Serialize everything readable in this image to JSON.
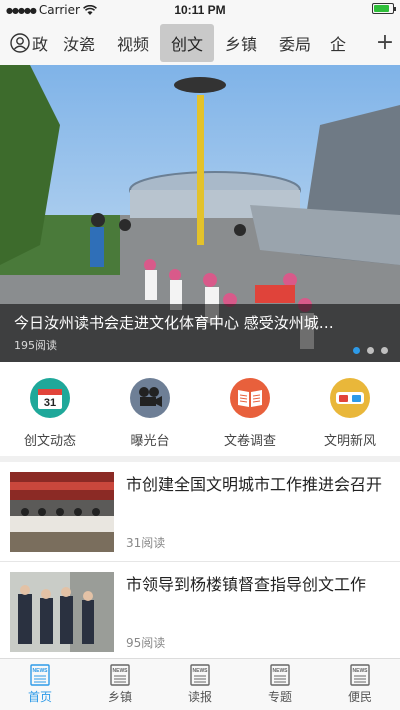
{
  "status": {
    "carrier": "Carrier",
    "time": "10:11 PM",
    "battery_level": 0.85
  },
  "nav": {
    "tabs": [
      {
        "label": "政",
        "active": false
      },
      {
        "label": "汝瓷",
        "active": false
      },
      {
        "label": "视频",
        "active": false
      },
      {
        "label": "创文",
        "active": true
      },
      {
        "label": "乡镇",
        "active": false
      },
      {
        "label": "委局",
        "active": false
      },
      {
        "label": "企",
        "active": false
      }
    ],
    "plus": "+"
  },
  "banner": {
    "title": "今日汝州读书会走进文化体育中心  感受汝州城…",
    "reads": "195阅读",
    "page_count": 3,
    "active_page": 1
  },
  "quick_links": [
    {
      "label": "创文动态",
      "icon": "calendar-icon",
      "color": "#1fa89a",
      "icon_text": "31"
    },
    {
      "label": "曝光台",
      "icon": "film-camera-icon",
      "color": "#6e7f96"
    },
    {
      "label": "文卷调查",
      "icon": "open-book-icon",
      "color": "#e8603c"
    },
    {
      "label": "文明新风",
      "icon": "3d-glasses-icon",
      "color": "#e9b73a"
    }
  ],
  "news": [
    {
      "title": "市创建全国文明城市工作推进会召开",
      "reads": "31阅读"
    },
    {
      "title": "市领导到杨楼镇督查指导创文工作",
      "reads": "95阅读"
    }
  ],
  "tabbar": {
    "items": [
      {
        "label": "首页",
        "icon": "news-icon",
        "active": true
      },
      {
        "label": "乡镇",
        "icon": "news-icon",
        "active": false
      },
      {
        "label": "读报",
        "icon": "news-icon",
        "active": false
      },
      {
        "label": "专题",
        "icon": "news-icon",
        "active": false
      },
      {
        "label": "便民",
        "icon": "news-icon",
        "active": false
      }
    ],
    "icon_text": "NEWS",
    "active_color": "#2d9ae8"
  }
}
